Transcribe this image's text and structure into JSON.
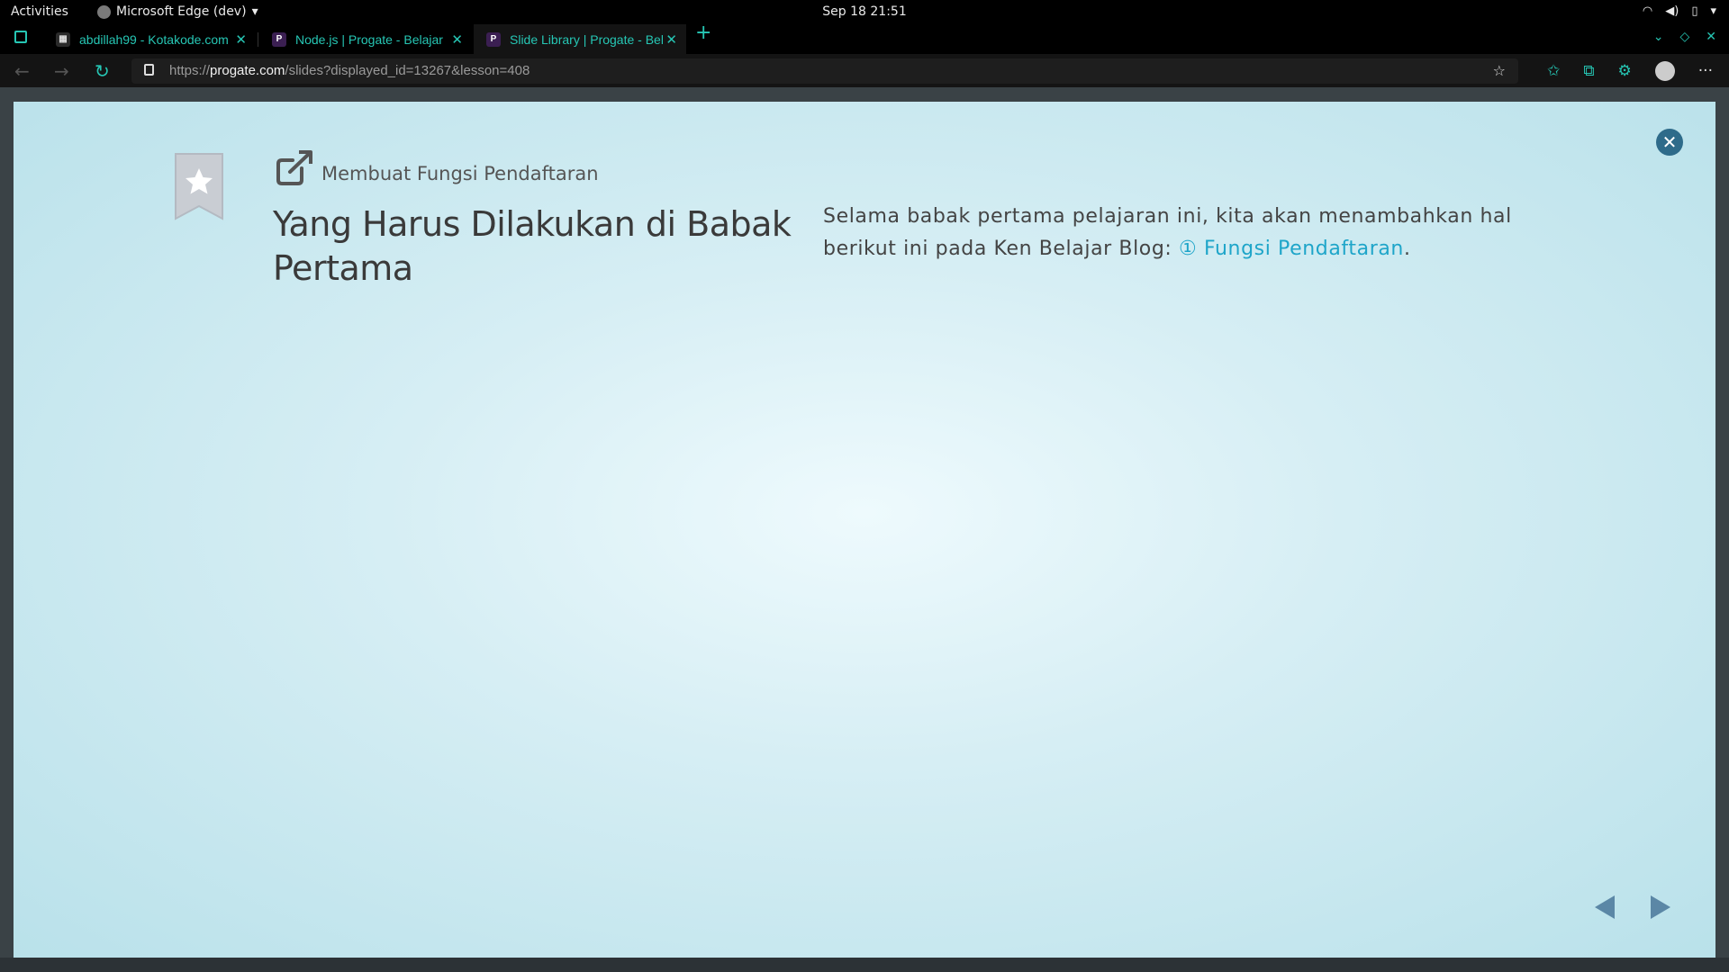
{
  "system": {
    "activities": "Activities",
    "app_name": "Microsoft Edge (dev)",
    "clock": "Sep 18  21:51"
  },
  "tabs": [
    {
      "title": "abdillah99 - Kotakode.com",
      "favicon": "kotakode-favicon"
    },
    {
      "title": "Node.js | Progate - Belajar",
      "favicon": "progate-favicon"
    },
    {
      "title": "Slide Library | Progate - Belajar",
      "favicon": "progate-favicon"
    }
  ],
  "address_bar": {
    "prefix": "https://",
    "host": "progate.com",
    "path": "/slides?displayed_id=13267&lesson=408"
  },
  "slide": {
    "chapter": "Membuat Fungsi Pendaftaran",
    "title": "Yang Harus Dilakukan di Babak Pertama",
    "text_before_link": "Selama babak pertama pelajaran ini, kita akan menambahkan hal berikut ini pada Ken Belajar Blog: ",
    "link_text": "① Fungsi Pendaftaran",
    "text_after_link": "."
  },
  "colors": {
    "accent": "#26c6b4",
    "link": "#1ea5c9",
    "nav_arrow": "#5b87a6",
    "close_button": "#2e6b8a"
  }
}
